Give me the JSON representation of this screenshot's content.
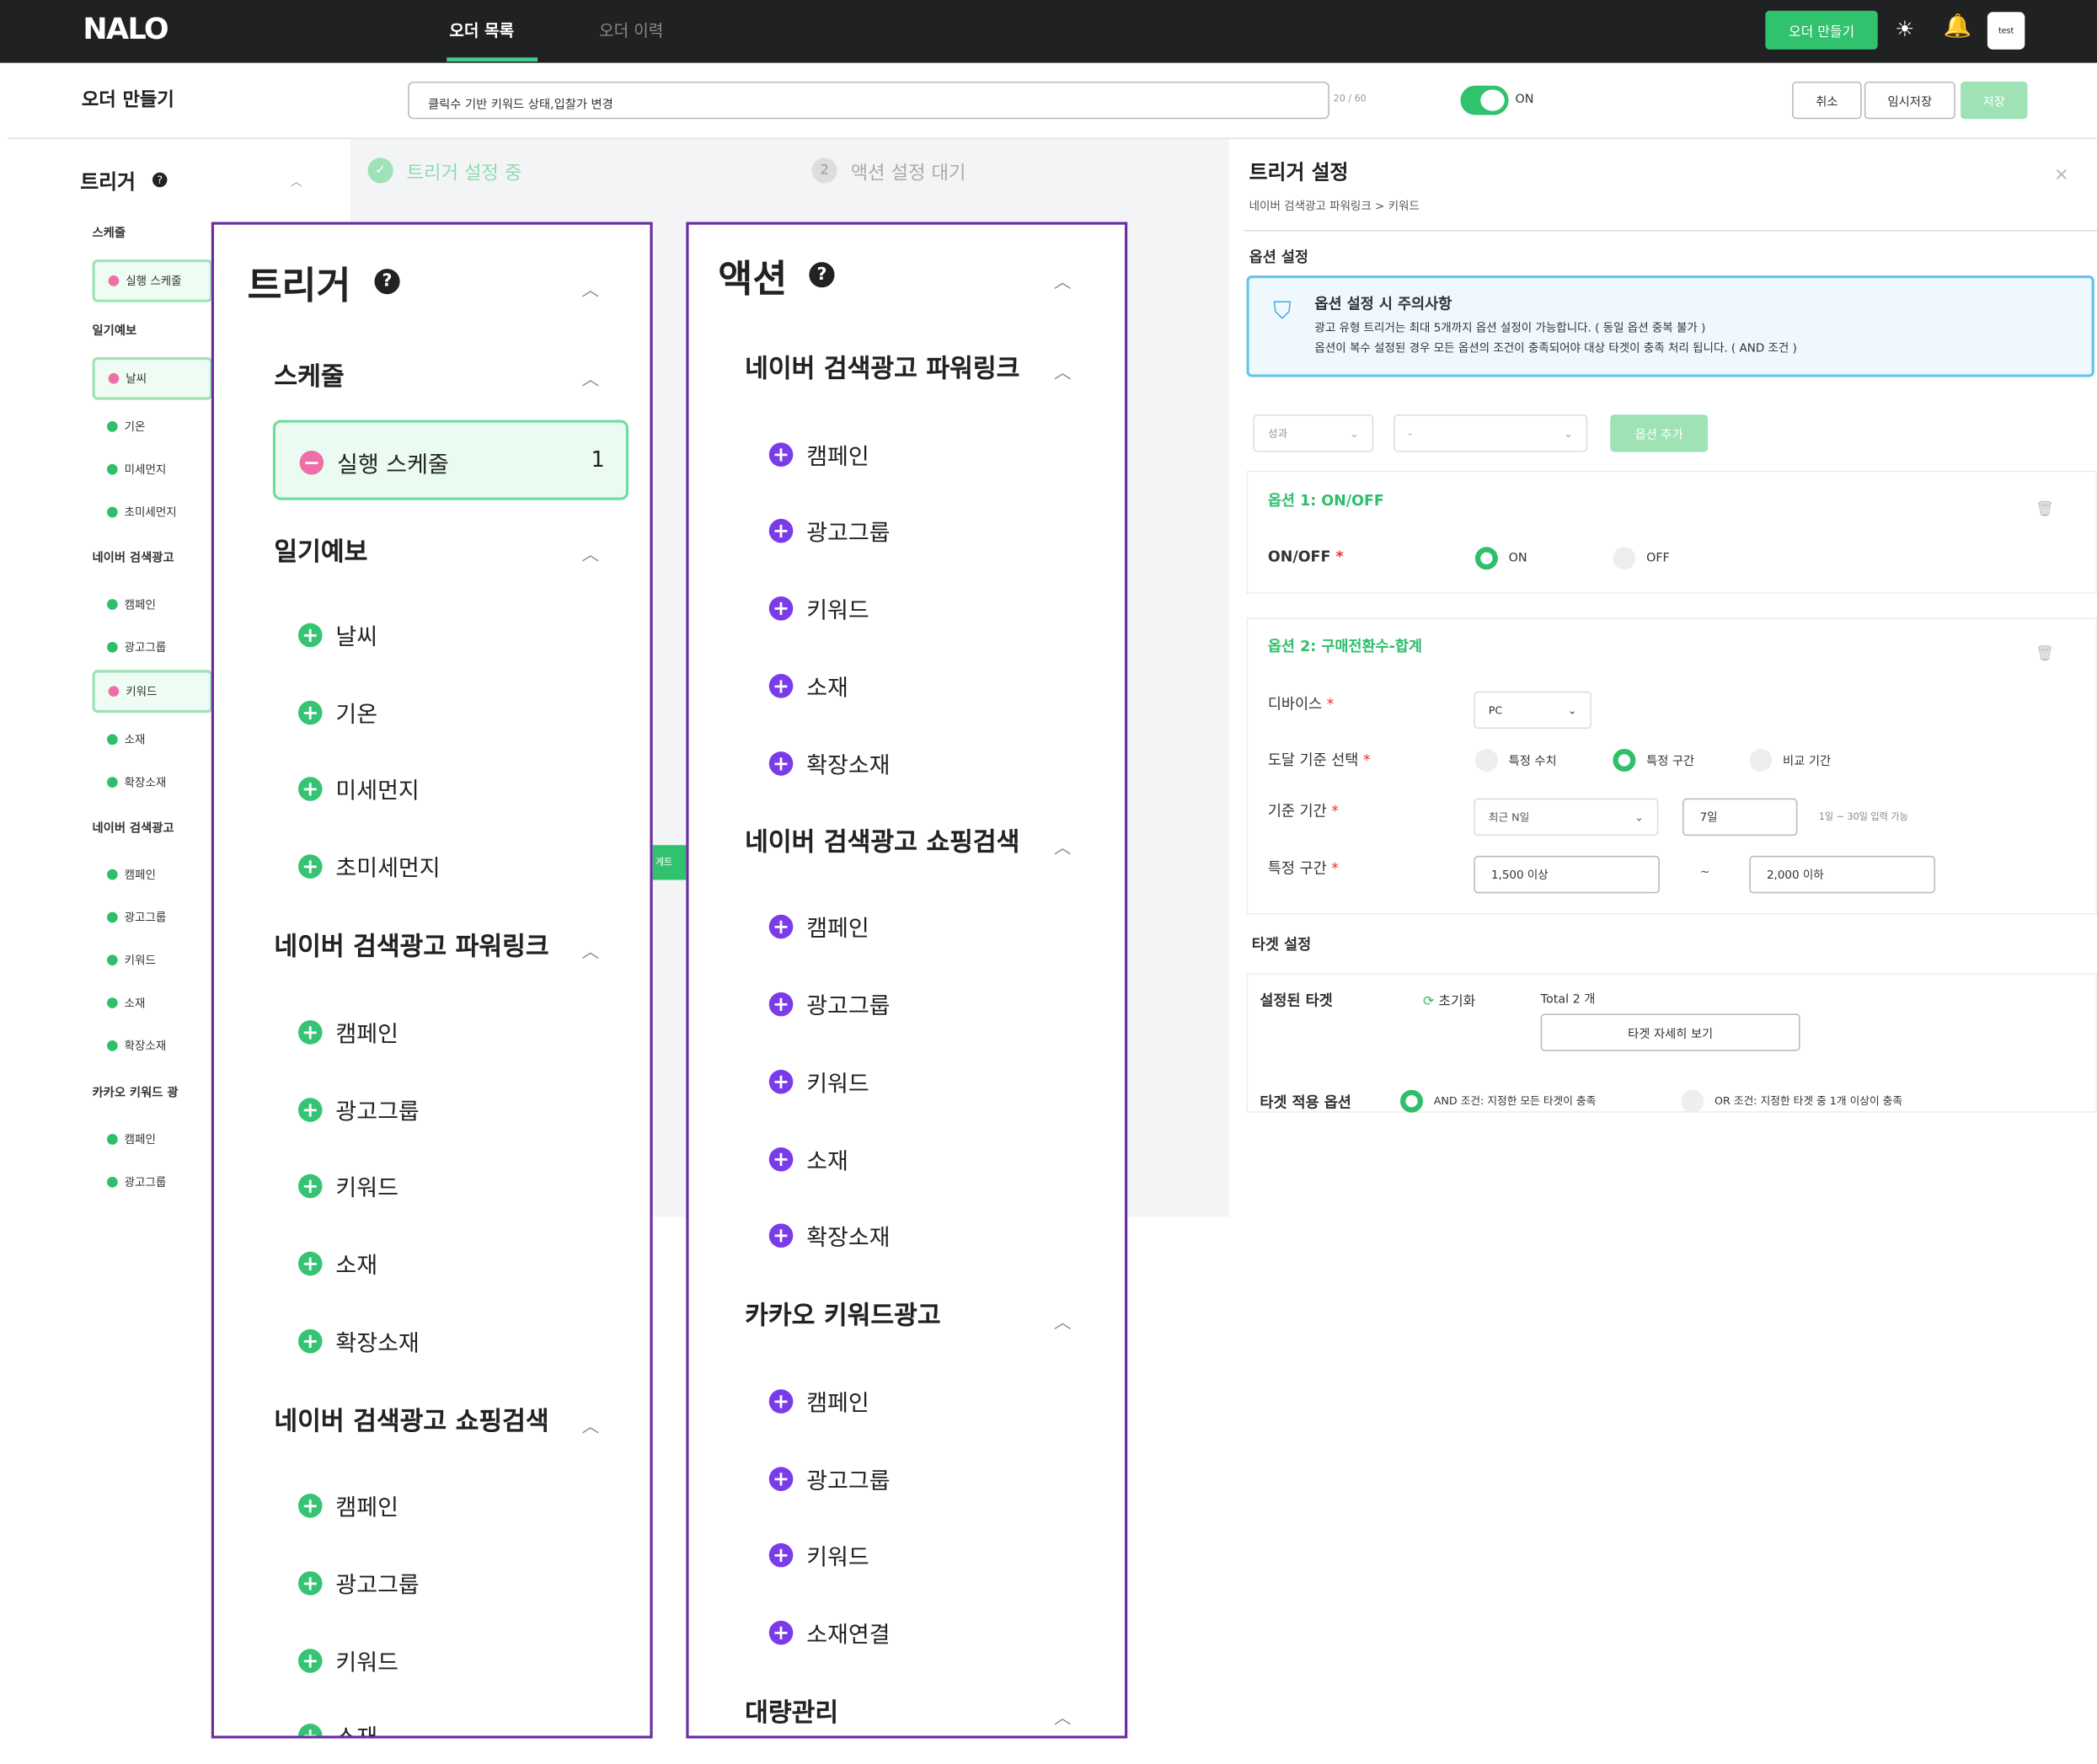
{
  "header": {
    "logo": "NALO",
    "tabs": [
      "오더 목록",
      "오더 이력"
    ],
    "create_button": "오더 만들기",
    "avatar": "test"
  },
  "form": {
    "title": "오더 만들기",
    "name_value": "클릭수 기반 키워드 상태,입찰가 변경",
    "counter": "20 / 60",
    "toggle_label": "ON",
    "cancel": "취소",
    "temp_save": "임시저장",
    "save": "저장"
  },
  "steps": {
    "step1_num": "✓",
    "step1": "트리거 설정 중",
    "step2_num": "2",
    "step2": "액션 설정 대기"
  },
  "left_panel": {
    "title": "트리거",
    "groups": [
      {
        "label": "스케줄",
        "items": [
          "실행 스케줄"
        ]
      },
      {
        "label": "일기예보",
        "items": [
          "날씨",
          "기온",
          "미세먼지",
          "초미세먼지"
        ]
      },
      {
        "label": "네이버 검색광고",
        "items": [
          "캠페인",
          "광고그룹",
          "키워드",
          "소재",
          "확장소재"
        ]
      },
      {
        "label": "네이버 검색광고",
        "items": [
          "캠페인",
          "광고그룹",
          "키워드",
          "소재",
          "확장소재"
        ]
      },
      {
        "label": "카카오 키워드 광",
        "items": [
          "캠페인",
          "광고그룹"
        ]
      }
    ],
    "mid_tag": "게트"
  },
  "trigger_panel": {
    "title": "트리거",
    "help": "?",
    "schedule_group": "스케줄",
    "schedule_item": "실행 스케줄",
    "schedule_count": "1",
    "weather_group": "일기예보",
    "weather_items": [
      "날씨",
      "기온",
      "미세먼지",
      "초미세먼지"
    ],
    "powerlink_group": "네이버 검색광고 파워링크",
    "powerlink_items": [
      "캠페인",
      "광고그룹",
      "키워드",
      "소재",
      "확장소재"
    ],
    "shopping_group": "네이버 검색광고 쇼핑검색",
    "shopping_items": [
      "캠페인",
      "광고그룹",
      "키워드",
      "소재"
    ]
  },
  "action_panel": {
    "title": "액션",
    "help": "?",
    "powerlink_group": "네이버 검색광고 파워링크",
    "powerlink_items": [
      "캠페인",
      "광고그룹",
      "키워드",
      "소재",
      "확장소재"
    ],
    "shopping_group": "네이버 검색광고 쇼핑검색",
    "shopping_items": [
      "캠페인",
      "광고그룹",
      "키워드",
      "소재",
      "확장소재"
    ],
    "kakao_group": "카카오 키워드광고",
    "kakao_items": [
      "캠페인",
      "광고그룹",
      "키워드",
      "소재연결"
    ],
    "bulk_group": "대량관리"
  },
  "right_panel": {
    "title": "트리거 설정",
    "breadcrumb": "네이버 검색광고 파워링크 > 키워드",
    "option_settings": "옵션 설정",
    "notice_title": "옵션 설정 시 주의사항",
    "notice_line1": "광고 유형 트리거는 최대 5개까지 옵션 설정이 가능합니다. ( 동일 옵션 중복 불가 )",
    "notice_line2": "옵션이 복수 설정된 경우 모든 옵션의 조건이 충족되어야 대상 타겟이 충족 처리 됩니다. ( AND 조건 )",
    "select1": "성과",
    "select2": "-",
    "add_option": "옵션 추가",
    "option1": {
      "title": "옵션 1: ON/OFF",
      "label": "ON/OFF",
      "on": "ON",
      "off": "OFF"
    },
    "option2": {
      "title": "옵션 2: 구매전환수-합계",
      "device_label": "디바이스",
      "device_value": "PC",
      "criteria_label": "도달 기준 선택",
      "criteria_opts": [
        "특정 수치",
        "특정 구간",
        "비교 기간"
      ],
      "period_label": "기준 기간",
      "period_select": "최근 N일",
      "period_value": "7일",
      "period_hint": "1일 ~ 30일 입력 가능",
      "range_label": "특정 구간",
      "range_min": "1,500 이상",
      "range_sep": "~",
      "range_max": "2,000 이하"
    },
    "target_settings": "타겟 설정",
    "set_target": "설정된 타겟",
    "reset": "초기화",
    "total": "Total 2 개",
    "target_detail": "타겟 자세히 보기",
    "apply_label": "타겟 적용 옵션",
    "and_opt": "AND 조건: 지정한 모든 타겟이 충족",
    "or_opt": "OR 조건: 지정한 타겟 중 1개 이상이 충족",
    "required": "*"
  },
  "colors": {
    "brand_green": "#31c26d",
    "panel_border": "#6a2ea0",
    "trigger_dot": "#36c474",
    "action_dot": "#7a3ce8"
  }
}
